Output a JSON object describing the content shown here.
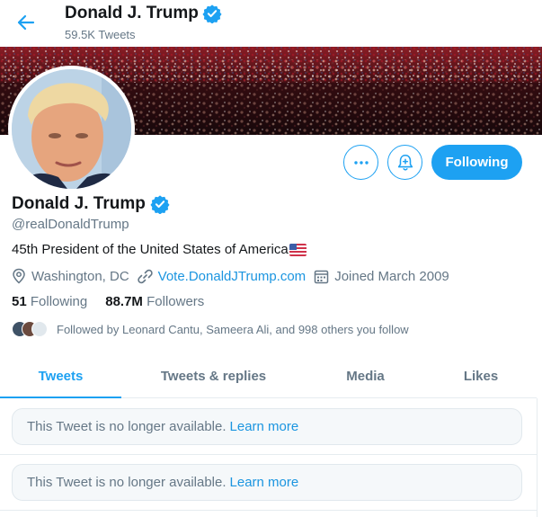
{
  "header": {
    "name": "Donald J. Trump",
    "tweet_count": "59.5K Tweets",
    "back_icon": "arrow-left-icon",
    "verified_icon": "verified-badge-icon"
  },
  "profile": {
    "name": "Donald J. Trump",
    "handle": "@realDonaldTrump",
    "bio": "45th President of the United States of America",
    "location": "Washington, DC",
    "website": "Vote.DonaldJTrump.com",
    "joined": "Joined March 2009",
    "following_count": "51",
    "following_label": "Following",
    "followers_count": "88.7M",
    "followers_label": "Followers",
    "followed_by": "Followed by Leonard Cantu, Sameera Ali, and 998 others you follow"
  },
  "actions": {
    "more_icon": "more-dots-icon",
    "notify_icon": "bell-plus-icon",
    "follow_label": "Following"
  },
  "tabs": [
    {
      "label": "Tweets",
      "active": true
    },
    {
      "label": "Tweets & replies",
      "active": false
    },
    {
      "label": "Media",
      "active": false
    },
    {
      "label": "Likes",
      "active": false
    }
  ],
  "tweets": [
    {
      "text": "This Tweet is no longer available.",
      "link": "Learn more"
    },
    {
      "text": "This Tweet is no longer available.",
      "link": "Learn more"
    }
  ],
  "colors": {
    "accent": "#1da1f2",
    "link": "#1b95e0",
    "secondary_text": "#657786",
    "primary_text": "#14171a",
    "border": "#e6ecf0"
  }
}
